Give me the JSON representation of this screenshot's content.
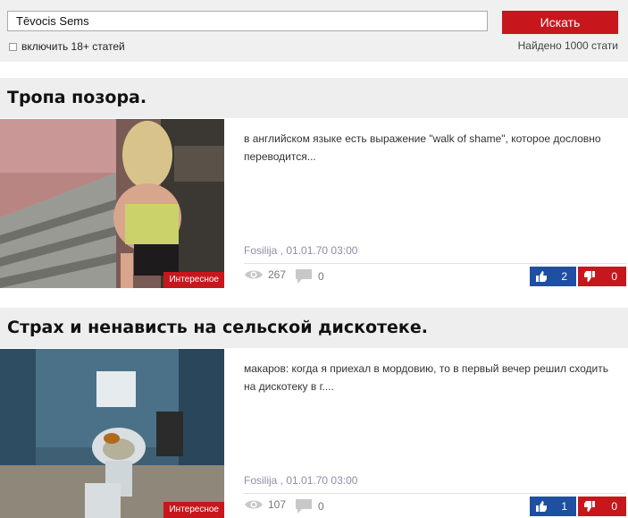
{
  "search": {
    "query": "Tēvocis Sems",
    "button_label": "Искать",
    "adult_label": "включить 18+ статей",
    "found_text": "Найдено 1000 стати"
  },
  "articles": [
    {
      "title": "Тропа позора.",
      "excerpt": "в английском языке есть выражение \"walk of shame\", которое дословно переводится...",
      "badge": "Интересное",
      "meta": "Fosilija , 01.01.70 03:00",
      "views": "267",
      "comments": "0",
      "likes": "2",
      "dislikes": "0"
    },
    {
      "title": "Страх и ненависть на сельской дискотеке.",
      "excerpt": "макаров: когда я приехал в мордовию, то в первый вечер решил сходить на дискотеку в г....",
      "badge": "Интересное",
      "meta": "Fosilija , 01.01.70 03:00",
      "views": "107",
      "comments": "0",
      "likes": "1",
      "dislikes": "0"
    }
  ],
  "colors": {
    "accent_red": "#c8161d",
    "like_blue": "#1f4fa0",
    "meta_gray": "#8a8fa6"
  }
}
